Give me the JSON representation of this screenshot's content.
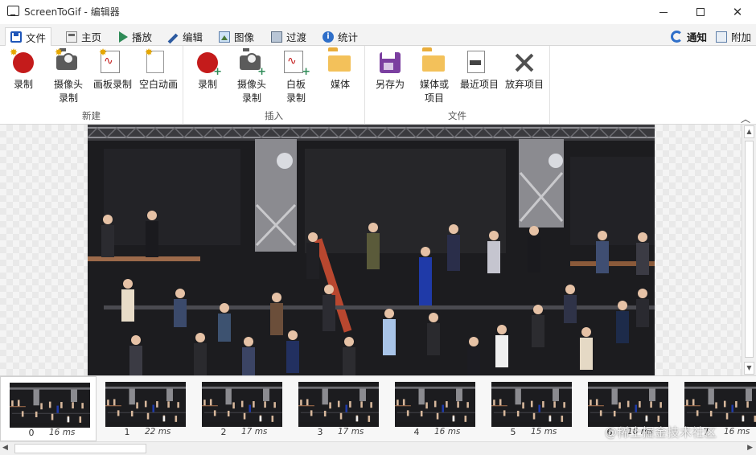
{
  "window": {
    "title": "ScreenToGif - 编辑器",
    "minimize_glyph": "—",
    "close_glyph": "✕"
  },
  "tabs": [
    {
      "label": "文件",
      "icon": "save-icon",
      "active": true
    },
    {
      "label": "主页",
      "icon": "home-icon"
    },
    {
      "label": "播放",
      "icon": "play-icon"
    },
    {
      "label": "编辑",
      "icon": "pencil-icon"
    },
    {
      "label": "图像",
      "icon": "image-icon"
    },
    {
      "label": "过渡",
      "icon": "transition-icon"
    },
    {
      "label": "统计",
      "icon": "info-icon"
    }
  ],
  "tabs_right": {
    "notify_label": "通知",
    "extras_label": "附加"
  },
  "ribbon": {
    "groups": [
      {
        "label": "新建",
        "buttons": [
          "录制",
          "摄像头录制",
          "画板录制",
          "空白动画"
        ]
      },
      {
        "label": "插入",
        "buttons": [
          "录制",
          "摄像头录制",
          "白板录制",
          "媒体"
        ]
      },
      {
        "label": "文件",
        "buttons": [
          "另存为",
          "媒体或项目",
          "最近项目",
          "放弃项目"
        ]
      }
    ],
    "new": {
      "record": "录制",
      "webcam": "摄像头录制",
      "board": "画板录制",
      "blank": "空白动画",
      "label": "新建"
    },
    "insert": {
      "record": "录制",
      "webcam": "摄像头录制",
      "board": "白板录制",
      "media": "媒体",
      "label": "插入"
    },
    "file": {
      "save_as": "另存为",
      "media_or_project": "媒体或项目",
      "recent": "最近项目",
      "discard": "放弃项目",
      "label": "文件"
    }
  },
  "timeline": {
    "frames": [
      {
        "number": "0",
        "delay": "16 ms"
      },
      {
        "number": "1",
        "delay": "22 ms"
      },
      {
        "number": "2",
        "delay": "17 ms"
      },
      {
        "number": "3",
        "delay": "17 ms"
      },
      {
        "number": "4",
        "delay": "16 ms"
      },
      {
        "number": "5",
        "delay": "15 ms"
      },
      {
        "number": "6",
        "delay": "16 ms"
      },
      {
        "number": "7",
        "delay": "16 ms"
      }
    ],
    "selected_index": 0
  },
  "watermark": "@稀土掘金技术社区",
  "colors": {
    "accent_blue": "#1f56b9",
    "record_red": "#c41b1b",
    "save_purple": "#7b3fa0",
    "folder_yellow": "#f3c15a"
  }
}
